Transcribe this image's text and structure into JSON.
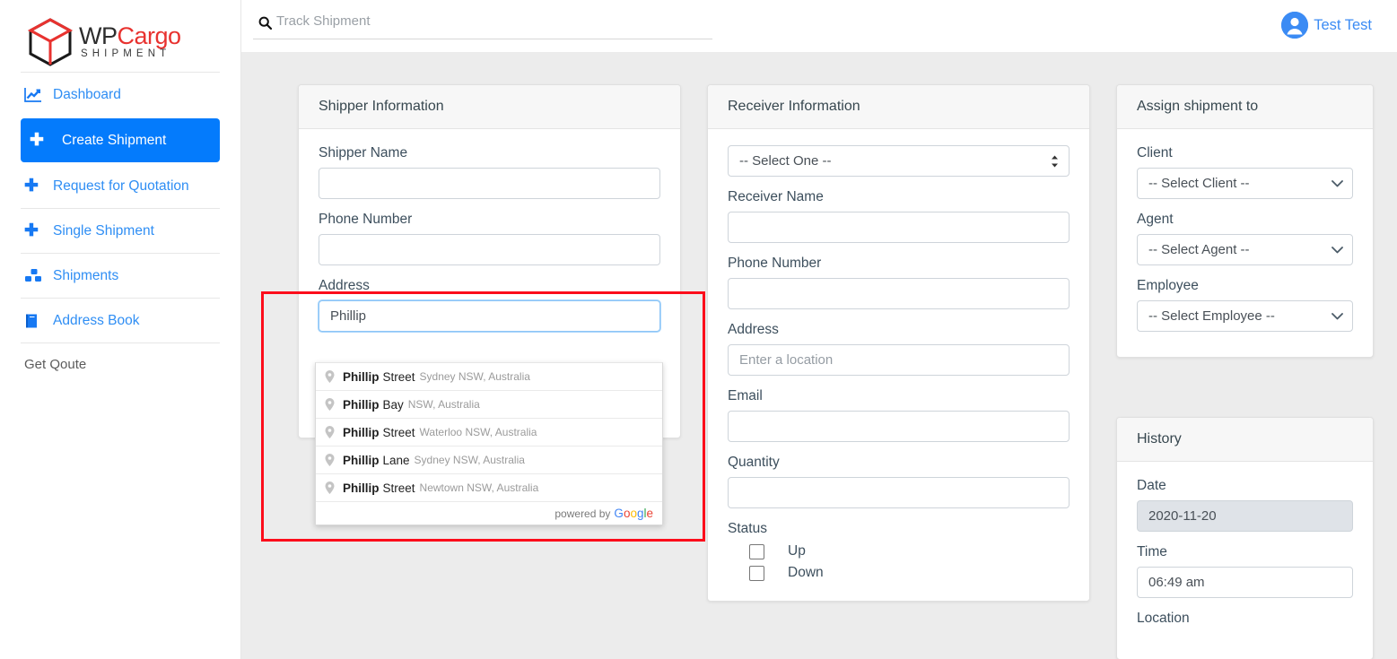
{
  "brand": {
    "name_part1": "WP",
    "name_part2": "Cargo",
    "tagline": "SHIPMENT",
    "logo_icon": "cargo-box-icon",
    "color_primary": "#e8322f",
    "color_dark": "#2d2d2d"
  },
  "sidebar": {
    "items": [
      {
        "label": "Dashboard",
        "icon": "chart-line-icon",
        "active": false
      },
      {
        "label": "Create Shipment",
        "icon": "plus-icon",
        "active": true
      },
      {
        "label": "Request for Quotation",
        "icon": "plus-icon",
        "active": false
      },
      {
        "label": "Single Shipment",
        "icon": "plus-icon",
        "active": false
      },
      {
        "label": "Shipments",
        "icon": "cubes-icon",
        "active": false
      },
      {
        "label": "Address Book",
        "icon": "book-icon",
        "active": false
      },
      {
        "label": "Get Qoute",
        "icon": "none",
        "active": false
      }
    ],
    "active_bg": "#047bfc",
    "link_color": "#2f8ef4"
  },
  "topbar": {
    "search": {
      "placeholder": "Track Shipment",
      "value": "",
      "icon": "search-icon"
    },
    "user": {
      "name": "Test Test",
      "avatar_icon": "user-circle-icon"
    }
  },
  "shipper": {
    "title": "Shipper Information",
    "fields": {
      "name_label": "Shipper Name",
      "name_value": "",
      "phone_label": "Phone Number",
      "phone_value": "",
      "address_label": "Address",
      "address_value": "Phillip"
    }
  },
  "autocomplete": {
    "suggestions": [
      {
        "bold": "Phillip",
        "rest": "Street",
        "secondary": "Sydney NSW, Australia"
      },
      {
        "bold": "Phillip",
        "rest": "Bay",
        "secondary": "NSW, Australia"
      },
      {
        "bold": "Phillip",
        "rest": "Street",
        "secondary": "Waterloo NSW, Australia"
      },
      {
        "bold": "Phillip",
        "rest": "Lane",
        "secondary": "Sydney NSW, Australia"
      },
      {
        "bold": "Phillip",
        "rest": "Street",
        "secondary": "Newtown NSW, Australia"
      }
    ],
    "footer_text": "powered by",
    "footer_brand": "Google",
    "pin_icon": "map-pin-icon"
  },
  "receiver": {
    "title": "Receiver Information",
    "select_value": "-- Select One --",
    "select_options": [
      "-- Select One --"
    ],
    "name_label": "Receiver Name",
    "name_value": "",
    "phone_label": "Phone Number",
    "phone_value": "",
    "address_label": "Address",
    "address_placeholder": "Enter a location",
    "address_value": "",
    "email_label": "Email",
    "email_value": "",
    "quantity_label": "Quantity",
    "quantity_value": "",
    "status_label": "Status",
    "status_options": [
      {
        "label": "Up",
        "checked": false
      },
      {
        "label": "Down",
        "checked": false
      }
    ]
  },
  "assign": {
    "title": "Assign shipment to",
    "rows": [
      {
        "label": "Client",
        "value": "-- Select Client --"
      },
      {
        "label": "Agent",
        "value": "-- Select Agent --"
      },
      {
        "label": "Employee",
        "value": "-- Select Employee --"
      }
    ]
  },
  "history": {
    "title": "History",
    "date_label": "Date",
    "date_value": "2020-11-20",
    "time_label": "Time",
    "time_value": "06:49 am",
    "location_label": "Location"
  },
  "annotation": {
    "color": "#fc0d1b",
    "target": "shipper-address-autocomplete"
  }
}
